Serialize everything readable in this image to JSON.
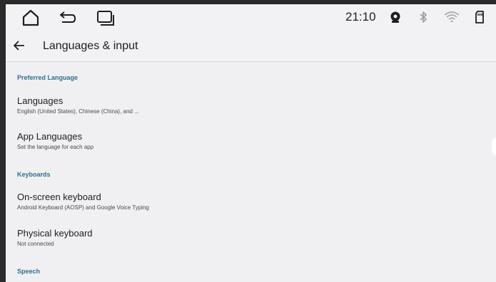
{
  "status_bar": {
    "clock": "21:10",
    "icons": [
      "home-icon",
      "back-nav-icon",
      "recents-icon",
      "camera-icon",
      "bluetooth-icon",
      "wifi-icon",
      "sd-card-icon"
    ]
  },
  "app_bar": {
    "title": "Languages & input",
    "back_icon": "back-arrow-icon"
  },
  "sections": [
    {
      "header": "Preferred Language",
      "items": [
        {
          "title": "Languages",
          "subtitle": "English (United States), Chinese (China), and ..."
        },
        {
          "title": "App Languages",
          "subtitle": "Set the language for each app"
        }
      ]
    },
    {
      "header": "Keyboards",
      "items": [
        {
          "title": "On-screen keyboard",
          "subtitle": "Android Keyboard (AOSP) and Google Voice Typing"
        },
        {
          "title": "Physical keyboard",
          "subtitle": "Not connected"
        }
      ]
    },
    {
      "header": "Speech",
      "items": []
    }
  ],
  "colors": {
    "accent": "#2f6f8e",
    "background": "#f0f0f3",
    "frame": "#2a2a2b"
  }
}
